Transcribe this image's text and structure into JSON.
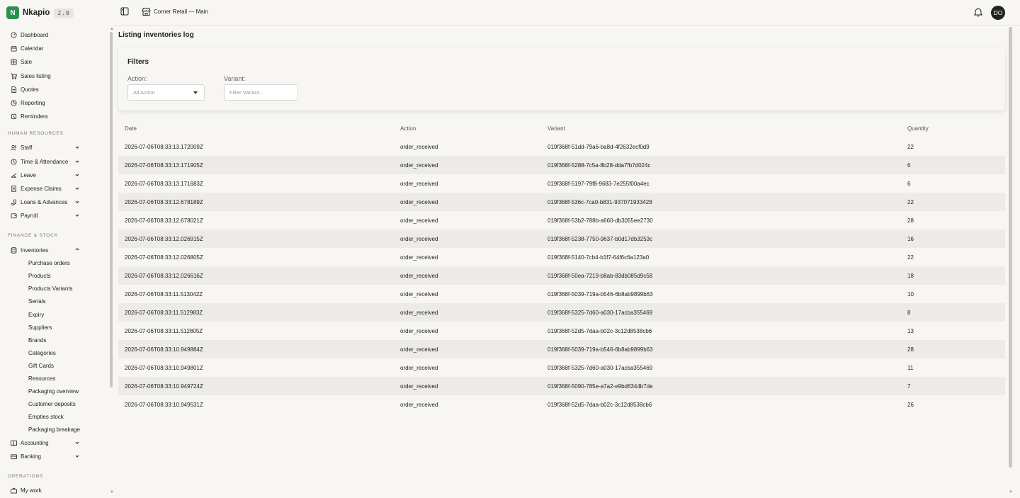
{
  "brand": {
    "letter": "N",
    "name": "Nkapio",
    "version": "2.0"
  },
  "topbar": {
    "store": "Corner Retail — Main",
    "avatar": "DO"
  },
  "nav": {
    "main": [
      "Dashboard",
      "Calendar",
      "Sale",
      "Sales listing",
      "Quotes",
      "Reporting",
      "Reminders"
    ],
    "hr_label": "HUMAN RESOURCES",
    "hr": [
      "Staff",
      "Time & Attendance",
      "Leave",
      "Expense Claims",
      "Loans & Advances",
      "Payroll"
    ],
    "finance_label": "FINANCE & STOCK",
    "inventories": "Inventories",
    "inventories_sub": [
      "Purchase orders",
      "Products",
      "Products Variants",
      "Serials",
      "Expiry",
      "Suppliers",
      "Brands",
      "Categories",
      "Gift Cards",
      "Resources",
      "Packaging overview",
      "Customer deposits",
      "Empties stock",
      "Packaging breakage"
    ],
    "finance_more": [
      "Accounting",
      "Banking"
    ],
    "ops_label": "OPERATIONS",
    "ops": [
      "My work"
    ]
  },
  "page": {
    "title": "Listing inventories log"
  },
  "filters": {
    "title": "Filters",
    "action_label": "Action:",
    "action_value": "All Action",
    "variant_label": "Variant:",
    "variant_placeholder": "Filter Variant..."
  },
  "table": {
    "headers": [
      "Date",
      "Action",
      "Variant",
      "Quantity"
    ],
    "rows": [
      [
        "2026-07-06T08:33:13.172009Z",
        "order_received",
        "019f368f-51dd-79a6-ba8d-4f2632ecf0d9",
        "22"
      ],
      [
        "2026-07-06T08:33:13.171905Z",
        "order_received",
        "019f368f-5288-7c5a-8b28-dda7fb7d024c",
        "6"
      ],
      [
        "2026-07-06T08:33:13.171683Z",
        "order_received",
        "019f368f-5197-79f8-9683-7e255f00a4ec",
        "6"
      ],
      [
        "2026-07-06T08:33:12.678189Z",
        "order_received",
        "019f368f-536c-7ca0-b831-937071933428",
        "22"
      ],
      [
        "2026-07-06T08:33:12.678021Z",
        "order_received",
        "019f368f-53b2-788b-a660-db3055ee2730",
        "28"
      ],
      [
        "2026-07-06T08:33:12.026915Z",
        "order_received",
        "019f368f-5238-7750-9637-b0d17db3253c",
        "16"
      ],
      [
        "2026-07-06T08:33:12.026805Z",
        "order_received",
        "019f368f-5140-7cb4-b1f7-64f6c6a123a0",
        "22"
      ],
      [
        "2026-07-06T08:33:12.026616Z",
        "order_received",
        "019f368f-50ea-7219-b8ab-83db085d9c58",
        "18"
      ],
      [
        "2026-07-06T08:33:11.513042Z",
        "order_received",
        "019f368f-5039-719a-b546-6b8ab9899b63",
        "10"
      ],
      [
        "2026-07-06T08:33:11.512983Z",
        "order_received",
        "019f368f-5325-7d60-a030-17acba355469",
        "8"
      ],
      [
        "2026-07-06T08:33:11.512805Z",
        "order_received",
        "019f368f-52d5-7daa-b02c-3c12d8538cb6",
        "13"
      ],
      [
        "2026-07-06T08:33:10.949884Z",
        "order_received",
        "019f368f-5039-719a-b546-6b8ab9899b63",
        "28"
      ],
      [
        "2026-07-06T08:33:10.949801Z",
        "order_received",
        "019f368f-5325-7d60-a030-17acba355469",
        "11"
      ],
      [
        "2026-07-06T08:33:10.949724Z",
        "order_received",
        "019f368f-5090-785e-a7a2-e9bd6344b7de",
        "7"
      ],
      [
        "2026-07-06T08:33:10.949531Z",
        "order_received",
        "019f368f-52d5-7daa-b02c-3c12d8538cb6",
        "26"
      ]
    ]
  },
  "colors": {
    "brand": "#2f8f4e",
    "background": "#f7f6f3",
    "row_alt": "#ecebe7"
  }
}
